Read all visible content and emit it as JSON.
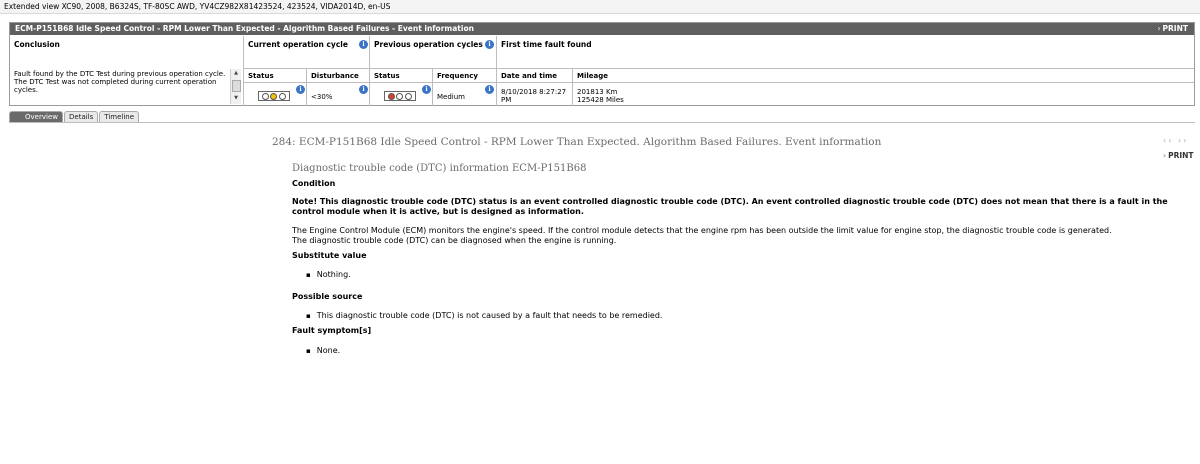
{
  "window": {
    "title": "Extended view   XC90, 2008, B6324S, TF-80SC AWD, YV4CZ982X81423524, 423524, VIDA2014D, en-US"
  },
  "header": {
    "title": "ECM-P151B68 Idle Speed Control - RPM Lower Than Expected - Algorithm Based Failures - Event information",
    "print_label": "PRINT"
  },
  "sections": {
    "conclusion": "Conclusion",
    "current_cycle": "Current operation cycle",
    "previous_cycles": "Previous operation cycles",
    "first_fault": "First time fault found"
  },
  "columns": {
    "current_status": "Status",
    "disturbance": "Disturbance",
    "previous_status": "Status",
    "frequency": "Frequency",
    "date_time": "Date and time",
    "mileage": "Mileage"
  },
  "values": {
    "conclusion_line1": "Fault found by the DTC Test during previous operation cycle.",
    "conclusion_line2": "The DTC Test was not completed during current operation cycles.",
    "current_status_lights": [
      "off",
      "amber",
      "off"
    ],
    "disturbance": "<30%",
    "previous_status_lights": [
      "red",
      "off",
      "off"
    ],
    "frequency": "Medium",
    "date_line1": "8/10/2018 8:27:27",
    "date_line2": "PM",
    "mileage_km": "201813 Km",
    "mileage_miles": "125428 Miles"
  },
  "tabs": [
    {
      "label": "Overview",
      "active": true
    },
    {
      "label": "Details",
      "active": false
    },
    {
      "label": "Timeline",
      "active": false
    }
  ],
  "document": {
    "heading": "284: ECM-P151B68 Idle Speed Control - RPM Lower Than Expected. Algorithm Based Failures. Event information",
    "print_label": "PRINT",
    "dtc_heading": "Diagnostic trouble code (DTC) information ECM-P151B68",
    "condition_title": "Condition",
    "note": "Note! This diagnostic trouble code (DTC) status is an event controlled diagnostic trouble code (DTC). An event controlled diagnostic trouble code (DTC) does not mean that there is a fault in the control module when it is active, but is designed as information.",
    "description_line1": "The Engine Control Module (ECM) monitors the engine's speed. If the control module detects that the engine rpm has been outside the limit value for engine stop, the diagnostic trouble code is generated.",
    "description_line2": "The diagnostic trouble code (DTC) can be diagnosed when the engine is running.",
    "substitute_title": "Substitute value",
    "substitute_item": "Nothing.",
    "source_title": "Possible source",
    "source_item": "This diagnostic trouble code (DTC) is not caused by a fault that needs to be remedied.",
    "symptom_title": "Fault symptom[s]",
    "symptom_item": "None."
  },
  "colors": {
    "header_bg": "#5f5f5f",
    "info_icon": "#3b73c7",
    "amber_light": "#f2c200",
    "red_light": "#d9402b",
    "heading_gray": "#6b6b6b"
  },
  "icons": [
    "info-icon",
    "scroll-up-icon",
    "scroll-down-icon",
    "prev-arrow-icon",
    "next-arrow-icon",
    "chevron-right-icon"
  ]
}
